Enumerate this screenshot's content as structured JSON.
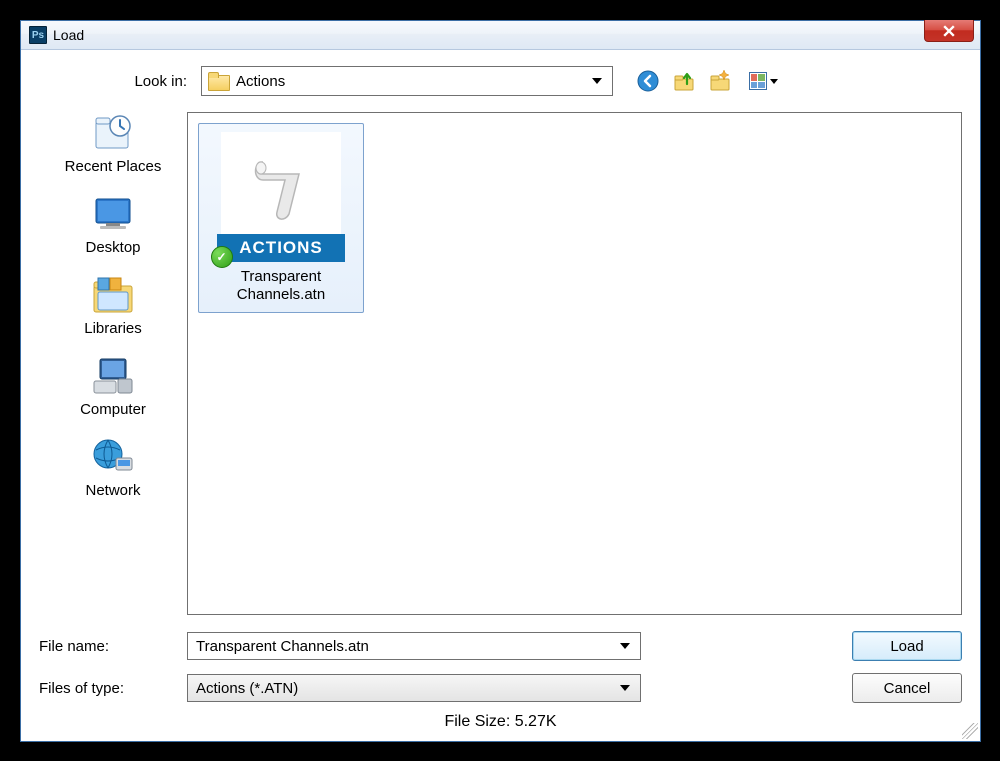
{
  "title": "Load",
  "appIconText": "Ps",
  "lookIn": {
    "label": "Look in:",
    "value": "Actions"
  },
  "toolbarIcons": {
    "back": "back-icon",
    "up": "up-one-level-icon",
    "newFolder": "new-folder-icon",
    "views": "views-menu-icon"
  },
  "sidebar": [
    {
      "key": "recent",
      "label": "Recent Places"
    },
    {
      "key": "desktop",
      "label": "Desktop"
    },
    {
      "key": "libraries",
      "label": "Libraries"
    },
    {
      "key": "computer",
      "label": "Computer"
    },
    {
      "key": "network",
      "label": "Network"
    }
  ],
  "files": [
    {
      "name": "Transparent Channels.atn",
      "badge": "ACTIONS"
    }
  ],
  "fileName": {
    "label": "File name:",
    "value": "Transparent Channels.atn"
  },
  "filesOfType": {
    "label": "Files of type:",
    "value": "Actions (*.ATN)"
  },
  "buttons": {
    "load": "Load",
    "cancel": "Cancel"
  },
  "fileSize": "File Size: 5.27K"
}
